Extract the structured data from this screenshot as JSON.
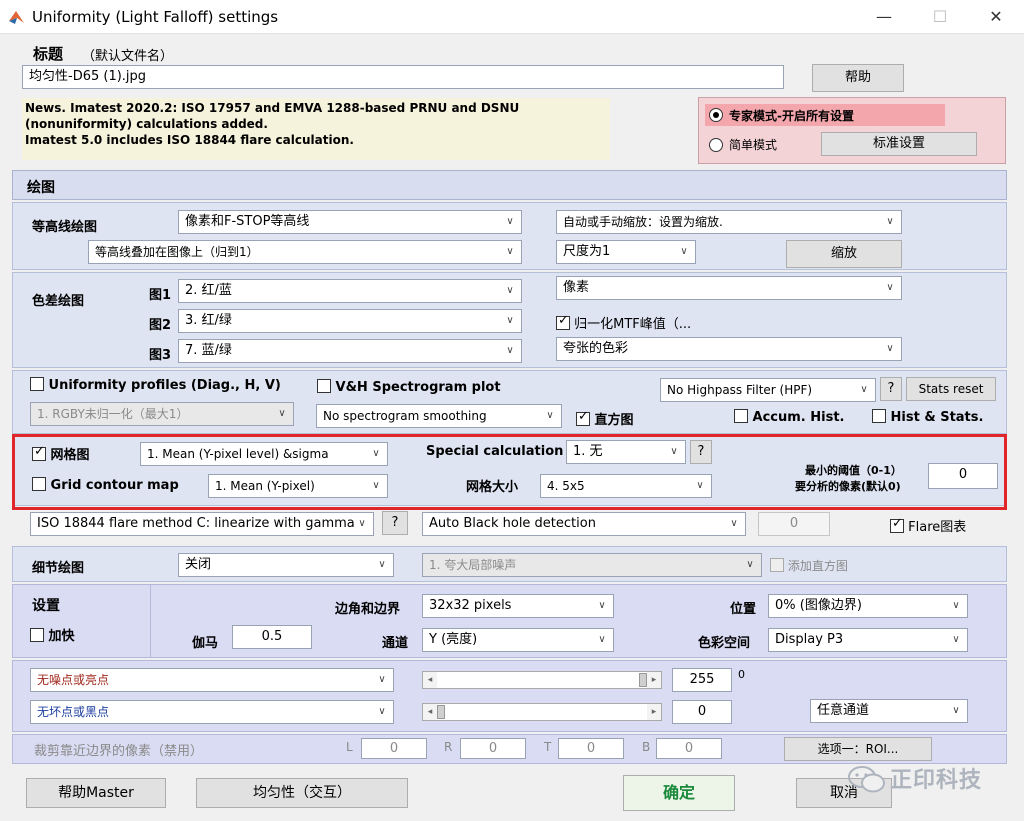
{
  "window": {
    "title": "Uniformity (Light Falloff) settings",
    "min": "—",
    "max": "☐",
    "close": "✕"
  },
  "header": {
    "title_label": "标题",
    "default_name_hint": "（默认文件名）",
    "filename": "均匀性-D65 (1).jpg",
    "help_button": "帮助",
    "news_line1": "News. Imatest 2020.2:  ISO 17957 and EMVA 1288-based PRNU and DSNU",
    "news_line2": "(nonuniformity) calculations added.",
    "news_line3": "Imatest 5.0 includes ISO 18844 flare calculation.",
    "expert_mode": "专家模式-开启所有设置",
    "simple_mode": "简单模式",
    "standard_settings": "标准设置"
  },
  "plots": {
    "section_title": "绘图",
    "contour_label": "等高线绘图",
    "contour_type": "像素和F-STOP等高线",
    "contour_overlay": "等高线叠加在图像上（归到1）",
    "scale_mode": "自动或手动缩放：设置为缩放.",
    "scale_value": "尺度为1",
    "zoom_button": "缩放",
    "color_diff_label": "色差绘图",
    "fig1_label": "图1",
    "fig1_value": "2.  红/蓝",
    "fig2_label": "图2",
    "fig2_value": "3.  红/绿",
    "fig3_label": "图3",
    "fig3_value": "7.  蓝/绿",
    "pixel_select": "像素",
    "normalize_mtf": "归一化MTF峰值（...",
    "exaggerated_color": "夸张的色彩",
    "uniformity_profiles": "Uniformity profiles (Diag., H, V)",
    "rgby_select": "1. RGBY未归一化（最大1）",
    "vh_spectrogram": "V&H Spectrogram plot",
    "spectrogram_smoothing": "No  spectrogram smoothing",
    "histogram": "直方图",
    "hpf_select": "No Highpass Filter (HPF)",
    "question": "?",
    "stats_reset": "Stats reset",
    "accum_hist": "Accum. Hist.",
    "hist_stats": "Hist & Stats.",
    "grid_plot": "网格图",
    "grid_mean": "1.  Mean (Y-pixel level) &sigma",
    "special_calc_label": "Special calculation",
    "special_calc_value": "1. 无",
    "grid_contour": "Grid contour map",
    "grid_contour_value": "1.  Mean (Y-pixel)",
    "grid_size_label": "网格大小",
    "grid_size_value": "4.   5x5",
    "min_threshold_line1": "最小的阈值（0-1）",
    "min_threshold_line2": "要分析的像素(默认0)",
    "min_threshold_value": "0",
    "flare_method": "ISO 18844 flare method C: linearize with gamma",
    "black_hole": "Auto Black hole detection",
    "black_hole_value": "0",
    "flare_chart": "Flare图表"
  },
  "detail": {
    "label": "细节绘图",
    "value": "关闭",
    "noise_select": "1.   夸大局部噪声",
    "add_histogram": "添加直方图"
  },
  "settings": {
    "title": "设置",
    "speedup": "加快",
    "gamma_label": "伽马",
    "gamma_value": "0.5",
    "corner_label": "边角和边界",
    "corner_value": "32x32 pixels",
    "channel_label": "通道",
    "channel_value": "Y (亮度)",
    "position_label": "位置",
    "position_value": "0% (图像边界)",
    "colorspace_label": "色彩空间",
    "colorspace_value": "Display P3"
  },
  "pixels": {
    "no_noise": "无噪点或亮点",
    "no_bad": "无坏点或黑点",
    "upper_value": "255",
    "upper_suffix": "0",
    "upper_fraction": 1.0,
    "lower_value": "0",
    "lower_fraction": 0.0,
    "any_channel": "任意通道"
  },
  "crop": {
    "label": "裁剪靠近边界的像素（禁用）",
    "l_label": "L",
    "l_value": "0",
    "r_label": "R",
    "r_value": "0",
    "t_label": "T",
    "t_value": "0",
    "b_label": "B",
    "b_value": "0",
    "option_button": "选项一：ROI..."
  },
  "footer": {
    "help_master": "帮助Master",
    "uniformity_interactive": "均匀性（交互）",
    "ok": "确定",
    "cancel": "取消",
    "watermark": "正印科技"
  },
  "colors": {
    "highlight": "#e0262b",
    "expert_pane": "#f4d3d6",
    "expert_selected": "#f4a6ad",
    "news_bg": "#f6f3dc",
    "ok_text": "#1a8a3a"
  }
}
